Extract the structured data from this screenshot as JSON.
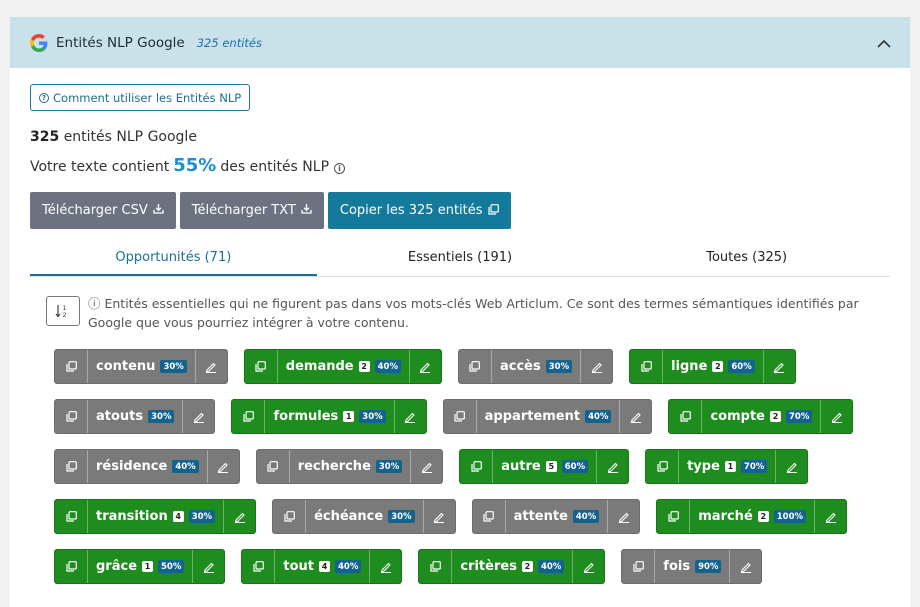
{
  "header": {
    "title": "Entités NLP Google",
    "count": "325 entités"
  },
  "help": {
    "label": "Comment utiliser les Entités NLP"
  },
  "summary": {
    "count_number": "325",
    "count_text": "entités NLP Google",
    "percent_prefix": "Votre texte contient",
    "percent_value": "55%",
    "percent_suffix": "des entités NLP"
  },
  "buttons": {
    "csv": "Télécharger CSV",
    "txt": "Télécharger TXT",
    "copy": "Copier les 325 entités"
  },
  "tabs": [
    {
      "label": "Opportunités (71)",
      "active": true
    },
    {
      "label": "Essentiels (191)",
      "active": false
    },
    {
      "label": "Toutes (325)",
      "active": false
    }
  ],
  "description": "ⓘ Entités essentielles qui ne figurent pas dans vos mots-clés Web Articlum. Ce sont des termes sémantiques identifiés par Google que vous pourriez intégrer à votre contenu.",
  "chip_rows": [
    [
      {
        "name": "contenu",
        "count": "",
        "pct": "30%",
        "color": "gray"
      },
      {
        "name": "demande",
        "count": "2",
        "pct": "40%",
        "color": "green"
      },
      {
        "name": "accès",
        "count": "",
        "pct": "30%",
        "color": "gray"
      },
      {
        "name": "ligne",
        "count": "2",
        "pct": "60%",
        "color": "green"
      }
    ],
    [
      {
        "name": "atouts",
        "count": "",
        "pct": "30%",
        "color": "gray"
      },
      {
        "name": "formules",
        "count": "1",
        "pct": "30%",
        "color": "green"
      },
      {
        "name": "appartement",
        "count": "",
        "pct": "40%",
        "color": "gray"
      },
      {
        "name": "compte",
        "count": "2",
        "pct": "70%",
        "color": "green"
      }
    ],
    [
      {
        "name": "résidence",
        "count": "",
        "pct": "40%",
        "color": "gray"
      },
      {
        "name": "recherche",
        "count": "",
        "pct": "30%",
        "color": "gray"
      },
      {
        "name": "autre",
        "count": "5",
        "pct": "60%",
        "color": "green"
      },
      {
        "name": "type",
        "count": "1",
        "pct": "70%",
        "color": "green"
      }
    ],
    [
      {
        "name": "transition",
        "count": "4",
        "pct": "30%",
        "color": "green"
      },
      {
        "name": "échéance",
        "count": "",
        "pct": "30%",
        "color": "gray"
      },
      {
        "name": "attente",
        "count": "",
        "pct": "40%",
        "color": "gray"
      },
      {
        "name": "marché",
        "count": "2",
        "pct": "100%",
        "color": "green"
      }
    ],
    [
      {
        "name": "grâce",
        "count": "1",
        "pct": "50%",
        "color": "green"
      },
      {
        "name": "tout",
        "count": "4",
        "pct": "40%",
        "color": "green"
      },
      {
        "name": "critères",
        "count": "2",
        "pct": "40%",
        "color": "green"
      },
      {
        "name": "fois",
        "count": "",
        "pct": "90%",
        "color": "gray"
      }
    ]
  ],
  "colors": {
    "header_bg": "#c9e2ea",
    "accent": "#137a9c",
    "percent": "#1a8fd6",
    "chip_green": "#1e8c1e",
    "chip_gray": "#7a7a7a"
  }
}
